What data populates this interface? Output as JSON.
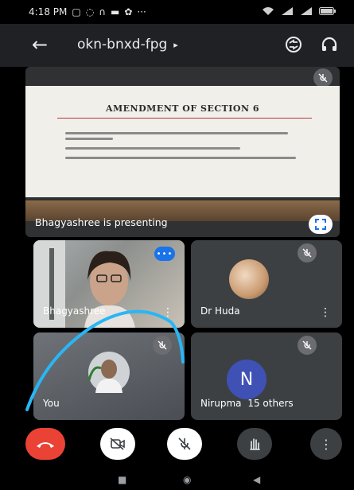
{
  "status_bar": {
    "time": "4:18 PM",
    "notification_icons": [
      "gallery-icon",
      "data-saver-icon",
      "headset-icon",
      "message-icon",
      "settings-icon"
    ],
    "overflow": "···",
    "system_icons": [
      "wifi-icon",
      "signal-icon",
      "battery-icon"
    ]
  },
  "top_bar": {
    "meeting_code": "okn-bnxd-fpg",
    "code_caret": "▸",
    "back_icon": "arrow-left-icon",
    "camera_switch_icon": "switch-camera-icon",
    "audio_icon": "headphones-icon"
  },
  "presentation": {
    "slide_title": "AMENDMENT OF SECTION 6",
    "presenter_label": "Bhagyashree is presenting"
  },
  "participants": [
    {
      "name": "Bhagyashree",
      "muted": false,
      "speaking": true
    },
    {
      "name": "Dr Huda",
      "muted": true
    },
    {
      "name": "You",
      "muted": true
    },
    {
      "name": "Nirupma",
      "avatar_letter": "N",
      "others": "15 others",
      "muted": true
    }
  ],
  "controls": {
    "end_call_icon": "end-call-icon",
    "camera_icon": "camera-off-icon",
    "mic_icon": "mic-off-icon",
    "hand_icon": "raise-hand-icon",
    "more_icon": "more-vert-icon"
  },
  "colors": {
    "end_call": "#ea4335",
    "accent_blue": "#1a73e8",
    "annotation_stroke": "#29b6f6",
    "avatar_indigo": "#3f51b5"
  }
}
